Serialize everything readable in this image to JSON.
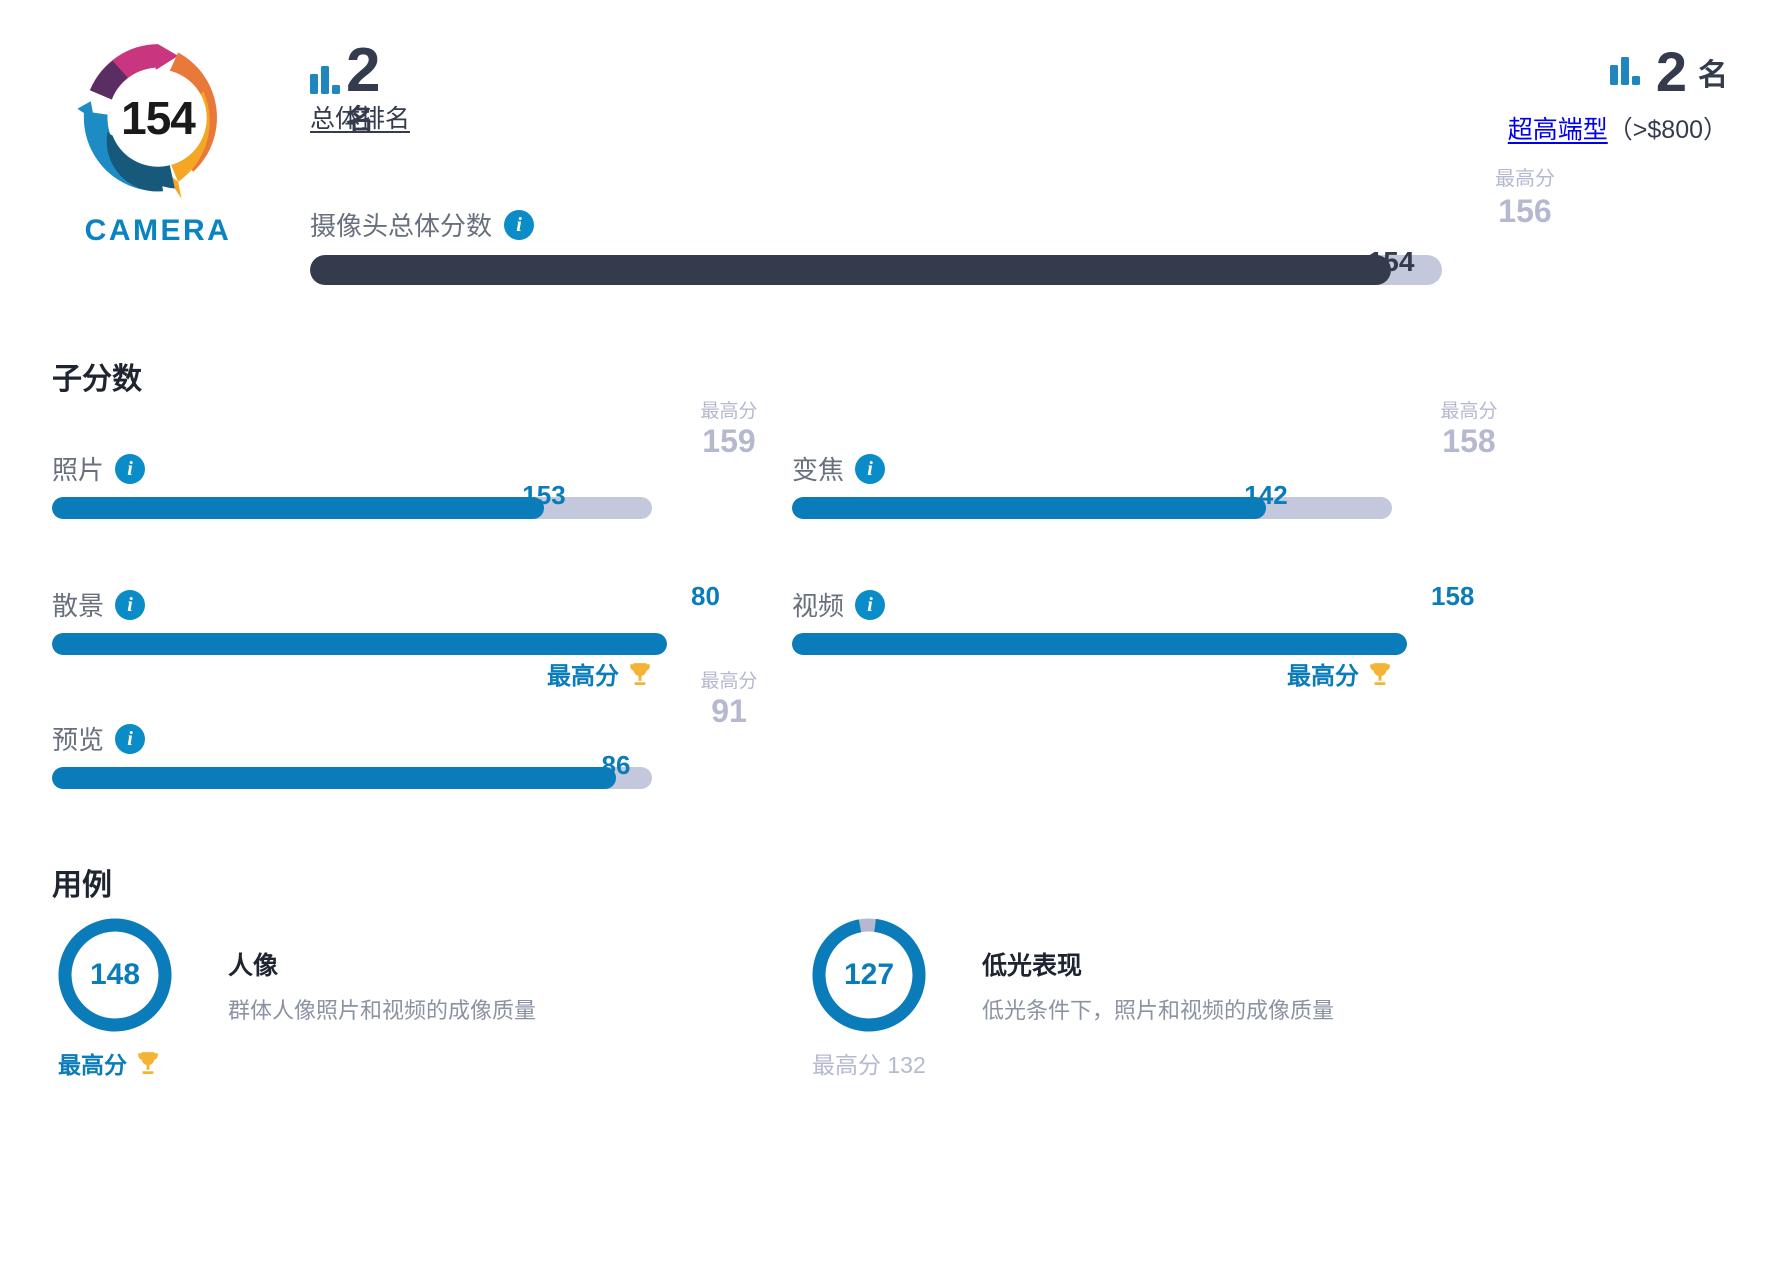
{
  "brand": {
    "score": "154",
    "word": "CAMERA",
    "ring_colors": {
      "magenta": "#c9357f",
      "purple": "#5a2d63",
      "orange": "#e8793a",
      "yellow": "#f5a623",
      "blue": "#1d8bc4",
      "dark_teal": "#17597a"
    }
  },
  "rank_overall": {
    "icon": "bar-chart-icon",
    "number": "2",
    "unit": "名",
    "link_label": "总体排名"
  },
  "rank_segment": {
    "icon": "bar-chart-icon",
    "number": "2",
    "unit": "名",
    "link_label": "超高端型",
    "suffix": "（>$800）"
  },
  "overall": {
    "label": "摄像头总体分数",
    "info_icon": "info-icon",
    "value": "154",
    "max_caption": "最高分",
    "max_value": "156",
    "fill_percent": 95.5,
    "fill_color": "#343b4d",
    "track_color": "#c4c8dd"
  },
  "sections": {
    "subscores_heading": "子分数",
    "usecases_heading": "用例"
  },
  "subscores": [
    {
      "name": "照片",
      "info_icon": "info-icon",
      "value": "153",
      "max_caption": "最高分",
      "max_value": "159",
      "fill_percent": 82.0,
      "is_best": false
    },
    {
      "name": "变焦",
      "info_icon": "info-icon",
      "value": "142",
      "max_caption": "最高分",
      "max_value": "158",
      "fill_percent": 79.0,
      "is_best": false
    },
    {
      "name": "散景",
      "info_icon": "info-icon",
      "value": "80",
      "max_caption": "",
      "max_value": "",
      "fill_percent": 100,
      "is_best": true,
      "best_label": "最高分",
      "best_icon": "trophy-icon"
    },
    {
      "name": "视频",
      "info_icon": "info-icon",
      "value": "158",
      "max_caption": "",
      "max_value": "",
      "fill_percent": 100,
      "is_best": true,
      "best_label": "最高分",
      "best_icon": "trophy-icon"
    },
    {
      "name": "预览",
      "info_icon": "info-icon",
      "value": "86",
      "max_caption": "最高分",
      "max_value": "91",
      "fill_percent": 94.0,
      "is_best": false
    }
  ],
  "usecases": [
    {
      "value": "148",
      "title": "人像",
      "description": "群体人像照片和视频的成像质量",
      "ring_percent": 100,
      "is_best": true,
      "best_label": "最高分",
      "best_icon": "trophy-icon",
      "max_label": ""
    },
    {
      "value": "127",
      "title": "低光表现",
      "description": "低光条件下，照片和视频的成像质量",
      "ring_percent": 95,
      "is_best": false,
      "best_label": "",
      "best_icon": "",
      "max_label": "最高分 132"
    }
  ],
  "colors": {
    "accent_blue": "#0a7cba",
    "info_blue": "#0a8cc8",
    "dark": "#343b4d",
    "muted": "#b4b9d0",
    "label_grey": "#68707e",
    "trophy_gold": "#f5b335"
  }
}
